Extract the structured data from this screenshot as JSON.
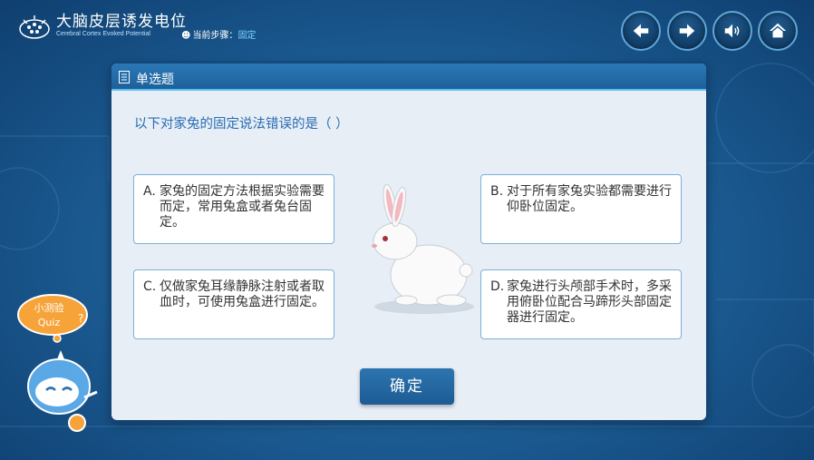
{
  "header": {
    "title": "大脑皮层诱发电位",
    "subtitle": "Cerebral Cortex Evoked Potential",
    "step_label": "当前步骤：",
    "step_value": "固定"
  },
  "nav": {
    "icons": [
      "arrow-left-icon",
      "arrow-right-icon",
      "speaker-icon",
      "home-icon"
    ]
  },
  "dialog": {
    "header": "单选题",
    "question": "以下对家兔的固定说法错误的是（    ）",
    "options": [
      {
        "letter": "A.",
        "text": "家兔的固定方法根据实验需要而定，常用兔盒或者兔台固定。"
      },
      {
        "letter": "B.",
        "text": "对于所有家兔实验都需要进行仰卧位固定。"
      },
      {
        "letter": "C.",
        "text": "仅做家兔耳缘静脉注射或者取血时，可使用兔盒进行固定。"
      },
      {
        "letter": "D.",
        "text": "家兔进行头颅部手术时，多采用俯卧位配合马蹄形头部固定器进行固定。"
      }
    ],
    "confirm": "确定"
  },
  "quiz": {
    "line1": "小测验",
    "line2": "Quiz"
  },
  "colors": {
    "accent": "#2a6db4",
    "header_bar": "#2b78b6",
    "background": "#1d5f97"
  }
}
